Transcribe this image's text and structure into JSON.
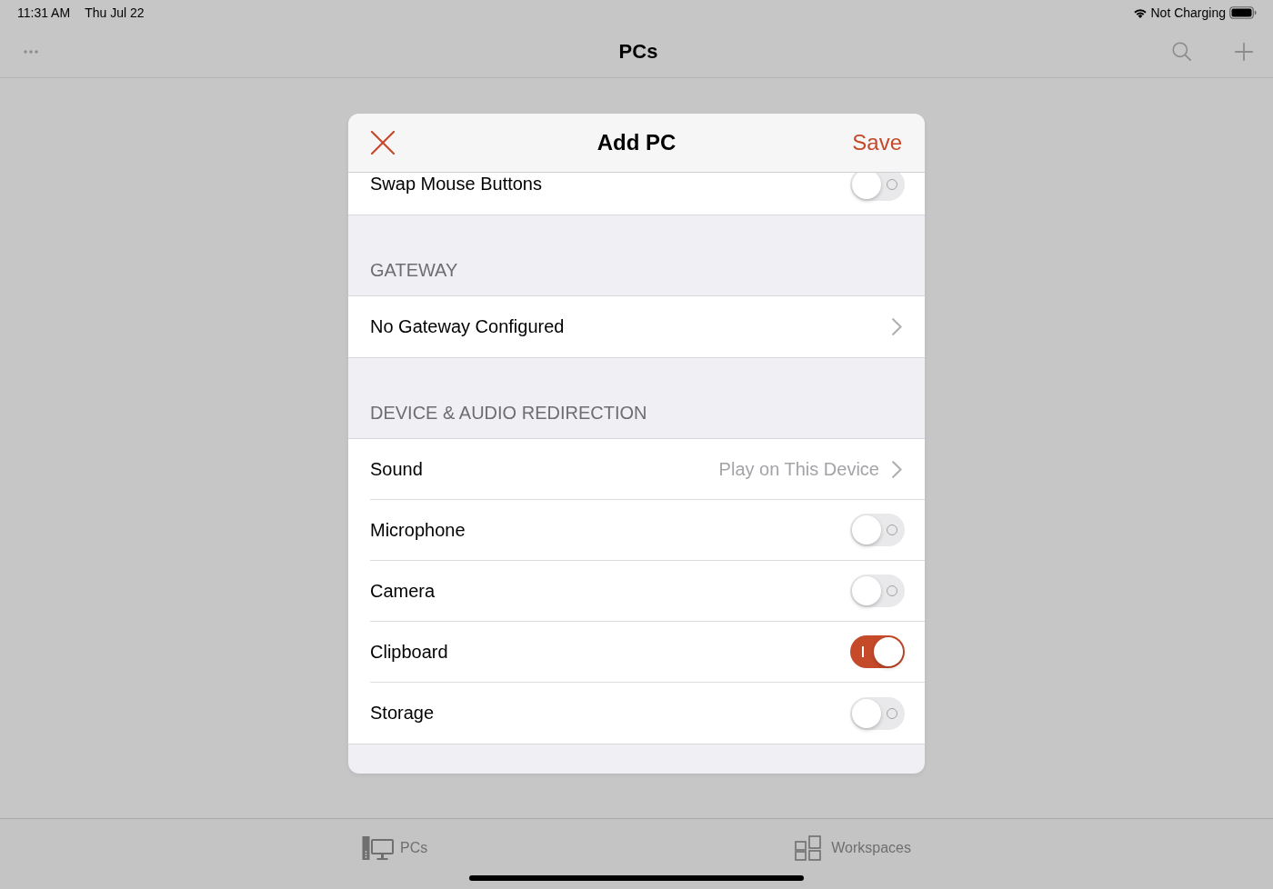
{
  "status_bar": {
    "time": "11:31 AM",
    "date": "Thu Jul 22",
    "battery_text": "Not Charging"
  },
  "nav_bar": {
    "title": "PCs"
  },
  "dialog": {
    "title": "Add PC",
    "save_button": "Save",
    "sections": [
      {
        "rows": [
          {
            "kind": "toggle",
            "label": "Swap Mouse Buttons",
            "on": false
          }
        ]
      },
      {
        "header": "GATEWAY",
        "rows": [
          {
            "kind": "link",
            "label": "No Gateway Configured"
          }
        ]
      },
      {
        "header": "DEVICE & AUDIO REDIRECTION",
        "rows": [
          {
            "kind": "link",
            "label": "Sound",
            "value": "Play on This Device"
          },
          {
            "kind": "toggle",
            "label": "Microphone",
            "on": false
          },
          {
            "kind": "toggle",
            "label": "Camera",
            "on": false
          },
          {
            "kind": "toggle",
            "label": "Clipboard",
            "on": true
          },
          {
            "kind": "toggle",
            "label": "Storage",
            "on": false
          }
        ]
      }
    ]
  },
  "tab_bar": {
    "tabs": [
      {
        "label": "PCs"
      },
      {
        "label": "Workspaces"
      }
    ]
  }
}
